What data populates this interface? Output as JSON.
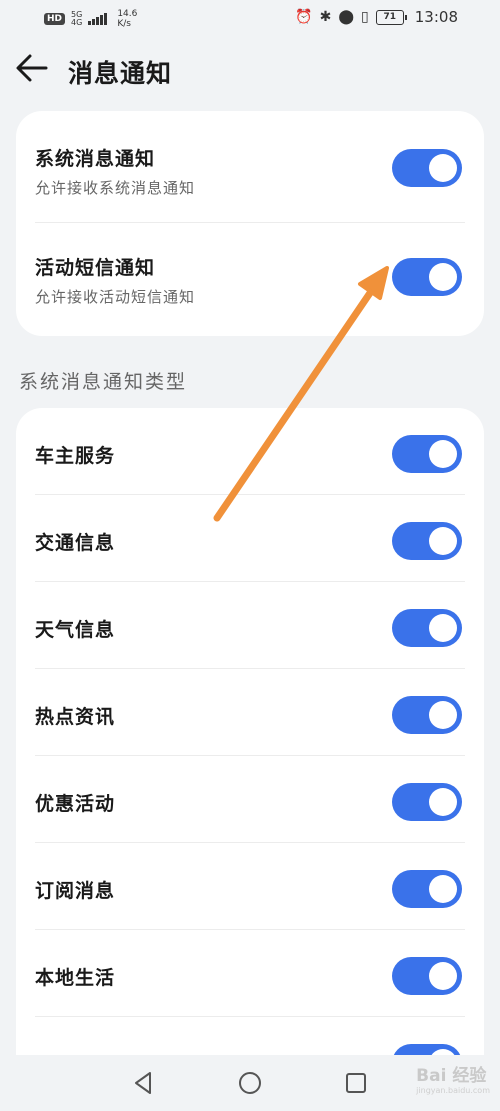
{
  "status_bar": {
    "hd": "HD",
    "signal_top": "5G",
    "signal_bottom": "4G",
    "speed_value": "14.6",
    "speed_unit": "K/s",
    "battery": "71",
    "time": "13:08",
    "icons": [
      "alarm-icon",
      "bluetooth-icon",
      "location-icon",
      "vibrate-icon"
    ]
  },
  "header": {
    "title": "消息通知",
    "back_icon": "arrow-left-icon"
  },
  "top_card": {
    "items": [
      {
        "title": "系统消息通知",
        "subtitle": "允许接收系统消息通知",
        "enabled": true
      },
      {
        "title": "活动短信通知",
        "subtitle": "允许接收活动短信通知",
        "enabled": true
      }
    ]
  },
  "section_label": "系统消息通知类型",
  "types_card": {
    "items": [
      {
        "title": "车主服务",
        "enabled": true
      },
      {
        "title": "交通信息",
        "enabled": true
      },
      {
        "title": "天气信息",
        "enabled": true
      },
      {
        "title": "热点资讯",
        "enabled": true
      },
      {
        "title": "优惠活动",
        "enabled": true
      },
      {
        "title": "订阅消息",
        "enabled": true
      },
      {
        "title": "本地生活",
        "enabled": true
      }
    ]
  },
  "nav_bar": {
    "icons": [
      "back-triangle-icon",
      "home-circle-icon",
      "recents-square-icon"
    ]
  },
  "watermark": {
    "text": "Bai 经验",
    "sub": "jingyan.baidu.com"
  },
  "colors": {
    "accent": "#3a72ea",
    "annotation_arrow": "#f0913a",
    "background": "#f1f3f5"
  }
}
